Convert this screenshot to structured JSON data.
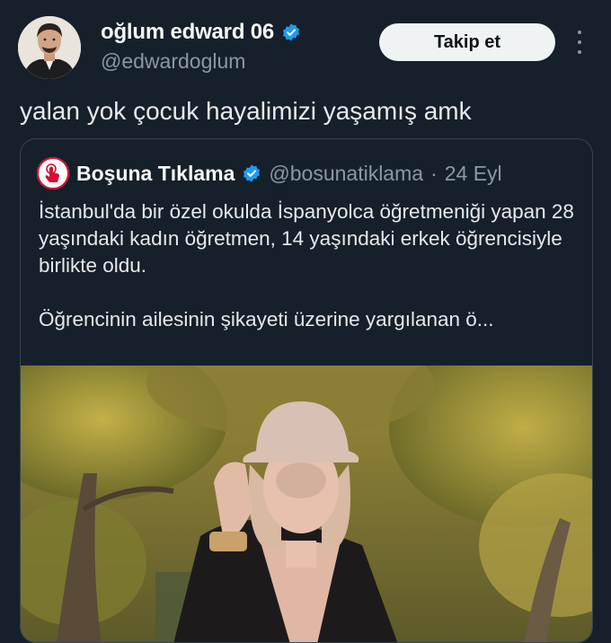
{
  "author": {
    "name": "oğlum edward 06",
    "handle": "@edwardoglum"
  },
  "follow_button": "Takip et",
  "tweet_text": "yalan yok çocuk hayalimizi yaşamış amk",
  "quoted": {
    "name": "Boşuna Tıklama",
    "handle": "@bosunatiklama",
    "separator": "·",
    "date": "24 Eyl",
    "paragraph1": "İstanbul'da bir özel okulda İspanyolca öğretmeniği yapan 28 yaşındaki kadın öğretmen, 14 yaşındaki erkek öğrencisiyle birlikte oldu.",
    "paragraph2": "Öğrencinin ailesinin şikayeti üzerine yargılanan ö..."
  },
  "icons": {
    "verified": "verified-badge-icon",
    "more": "more-options-icon",
    "quoted_avatar": "pointer-tap-logo-icon"
  },
  "colors": {
    "background": "#15202b",
    "verified": "#1d9bf0",
    "muted": "#8b98a5",
    "button_bg": "#eff3f4",
    "quoted_logo": "#d4102f"
  }
}
